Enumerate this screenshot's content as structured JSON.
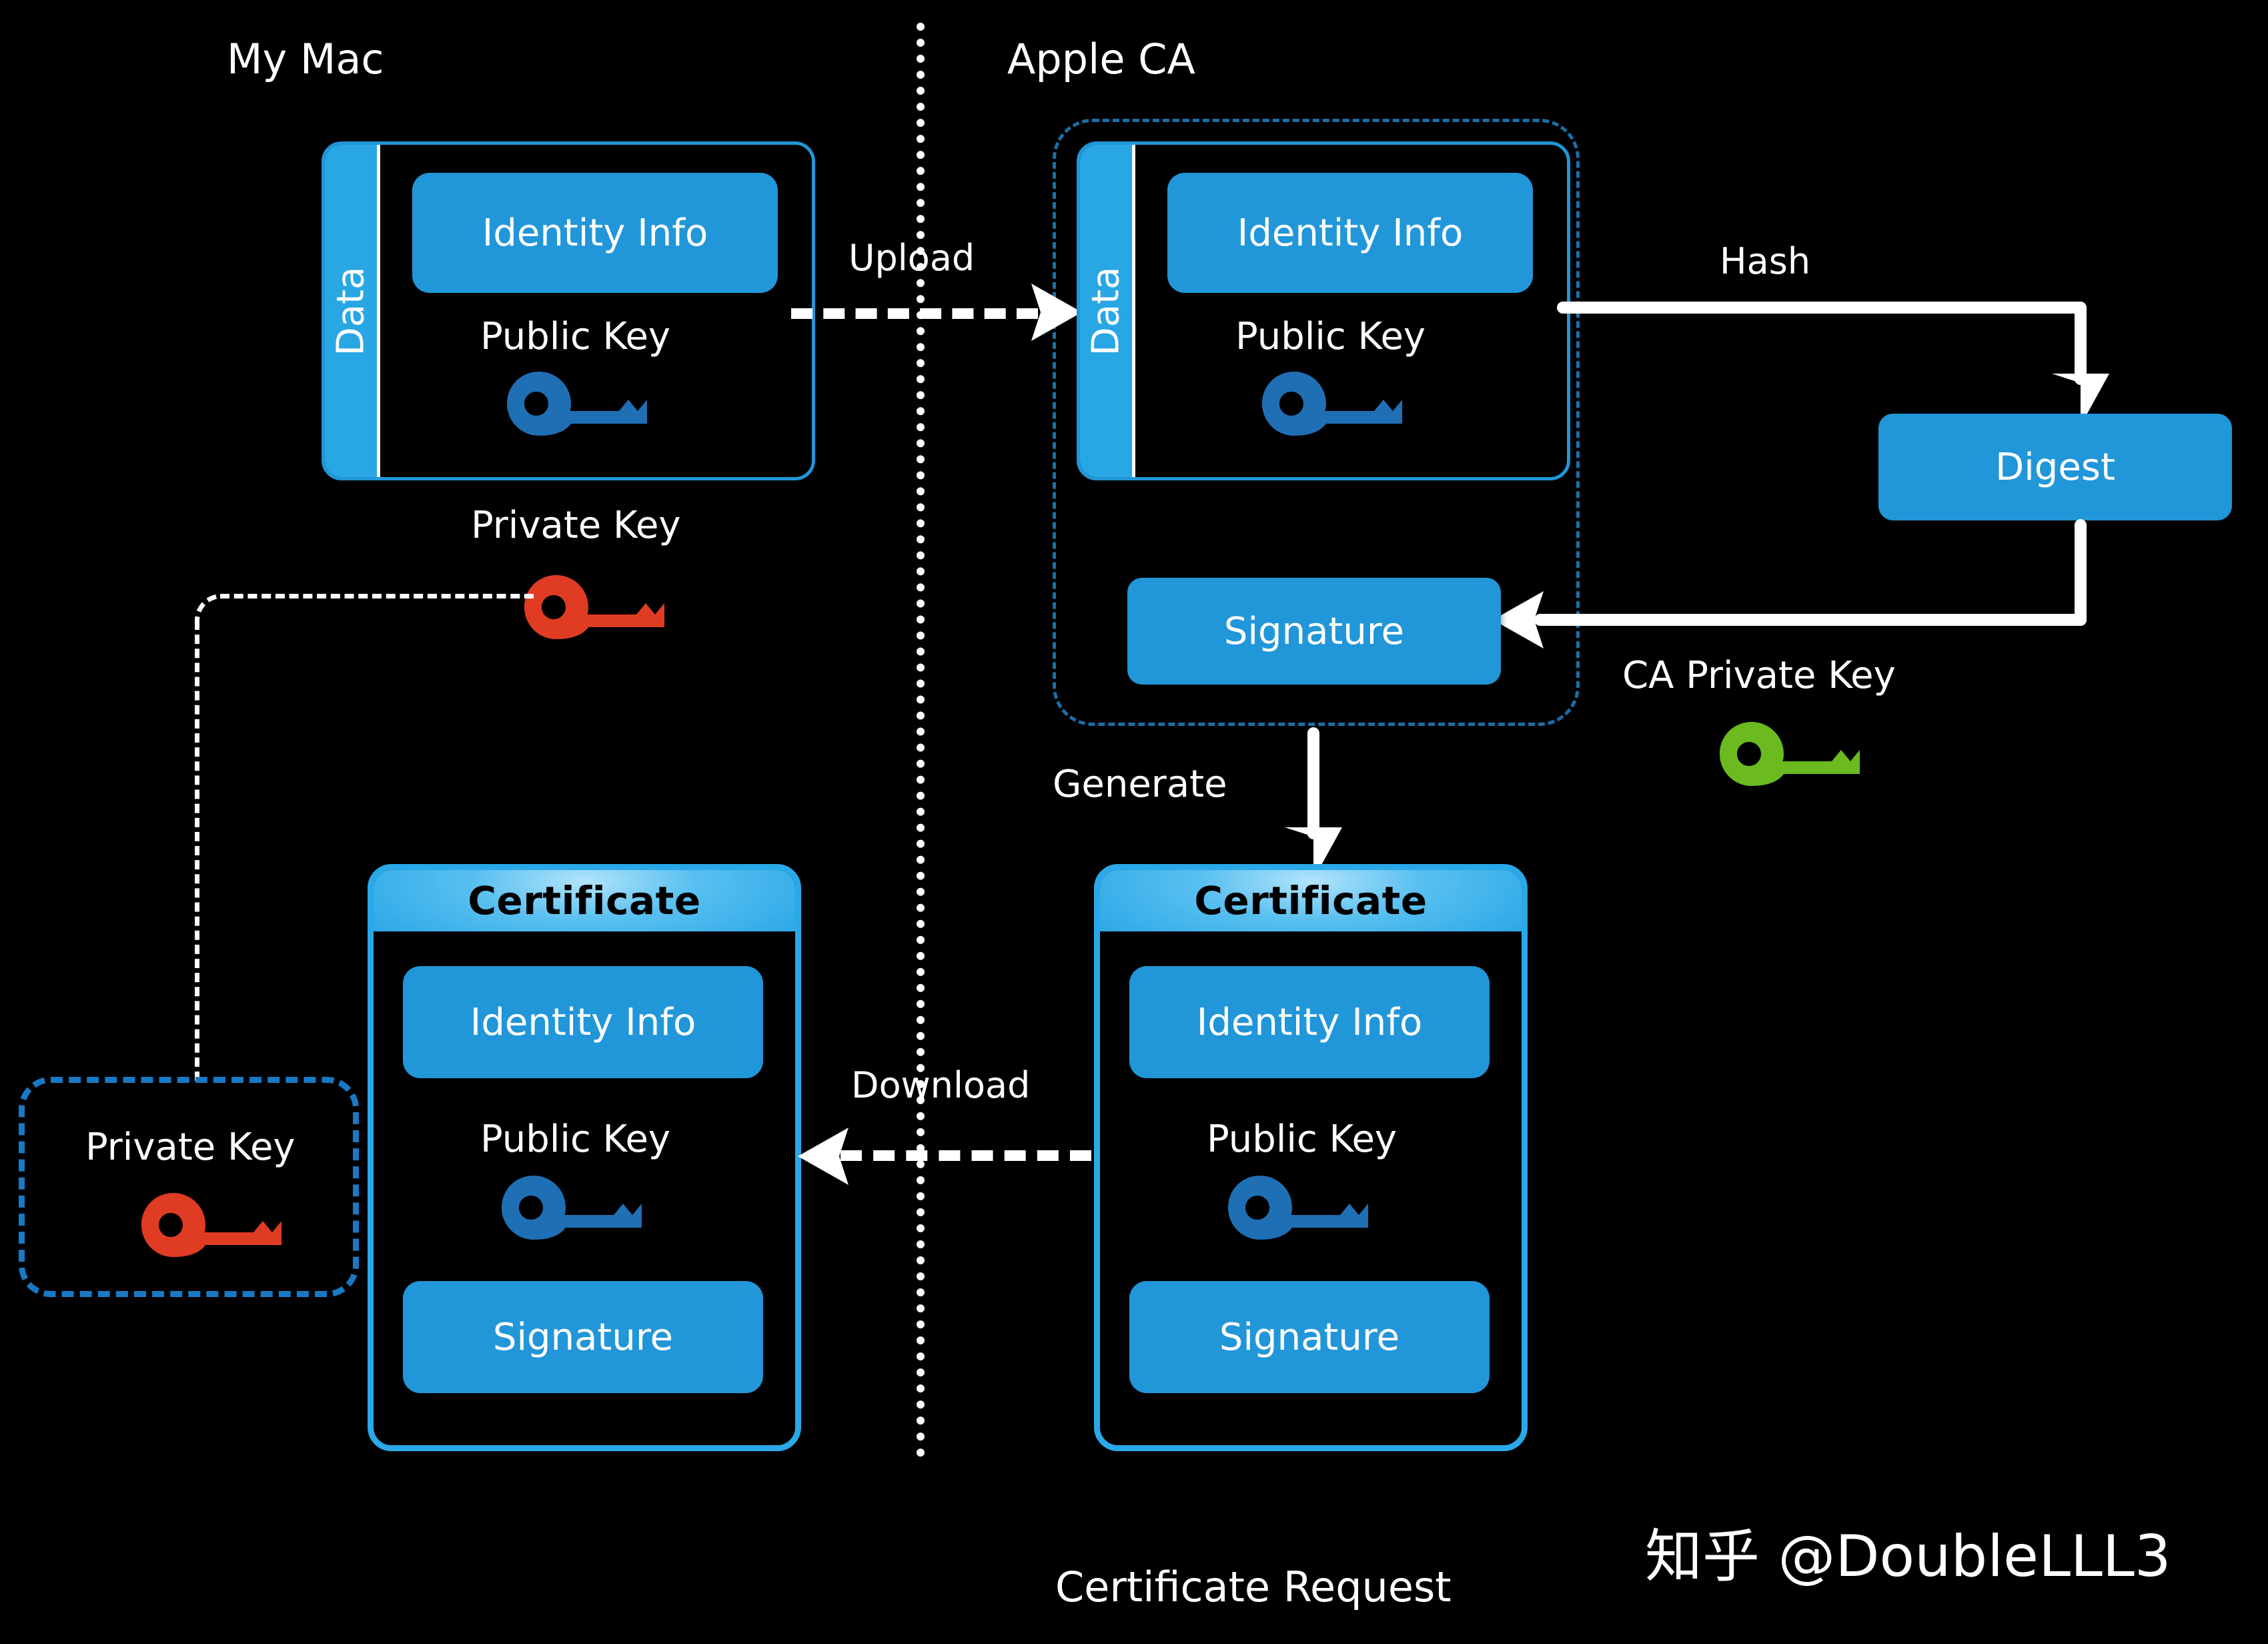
{
  "diagram": {
    "title": "Certificate Request",
    "background_color": "#000000",
    "accent_blue": "#2196d8",
    "light_blue": "#29a6e4",
    "key_blue": "#1f6fb5",
    "key_red": "#e03c23",
    "key_green": "#6aba20",
    "dashed_ca_color": "#1b6fa8",
    "dashed_pk_color": "#1a79c4"
  },
  "sections": {
    "left_title": "My Mac",
    "right_title": "Apple CA"
  },
  "my_mac": {
    "data_card": {
      "spine_label": "Data",
      "identity_label": "Identity Info",
      "public_key_label": "Public Key",
      "public_key_icon": "key-icon"
    },
    "private_key": {
      "label": "Private Key",
      "icon": "key-icon"
    }
  },
  "apple_ca": {
    "data_card": {
      "spine_label": "Data",
      "identity_label": "Identity Info",
      "public_key_label": "Public Key",
      "public_key_icon": "key-icon"
    },
    "signature_label": "Signature",
    "digest_label": "Digest",
    "ca_private_key": {
      "label": "CA Private Key",
      "icon": "key-icon"
    }
  },
  "arrows": {
    "upload": "Upload",
    "hash": "Hash",
    "generate": "Generate",
    "download": "Download"
  },
  "certificate_left": {
    "header": "Certificate",
    "identity_label": "Identity Info",
    "public_key_label": "Public Key",
    "public_key_icon": "key-icon",
    "signature_label": "Signature"
  },
  "certificate_right": {
    "header": "Certificate",
    "identity_label": "Identity Info",
    "public_key_label": "Public Key",
    "public_key_icon": "key-icon",
    "signature_label": "Signature"
  },
  "stored_private_key": {
    "label": "Private Key",
    "icon": "key-icon"
  },
  "caption": "Certificate Request",
  "watermark": "知乎 @DoubleLLL3"
}
